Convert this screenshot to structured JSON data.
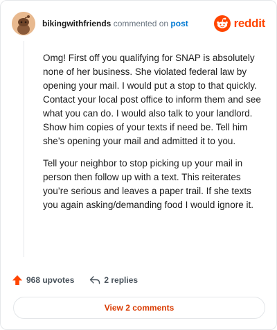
{
  "header": {
    "username": "bikingwithfriends",
    "action_text": "commented on",
    "post_link": "post",
    "brand": "reddit",
    "brand_color": "#ff4500"
  },
  "comment": {
    "paragraphs": [
      "Omg! First off you qualifying for SNAP is absolutely none of her business. She violated federal law by opening your mail. I would put a stop to that quickly. Contact your local post office to inform them and see what you can do. I would also talk to your landlord. Show him copies of your texts if need be. Tell him she’s opening your mail and admitted it to you.",
      "Tell your neighbor to stop picking up your mail in person then follow up with a text. This reiterates you’re serious and leaves a paper trail. If she texts you again asking/demanding food I would ignore it."
    ]
  },
  "actions": {
    "upvotes_label": "968 upvotes",
    "replies_label": "2 replies",
    "upvote_icon": "upvote-arrow-icon",
    "reply_icon": "reply-arrow-icon"
  },
  "footer": {
    "view_comments_label": "View 2 comments",
    "accent_color": "#d93a00"
  }
}
